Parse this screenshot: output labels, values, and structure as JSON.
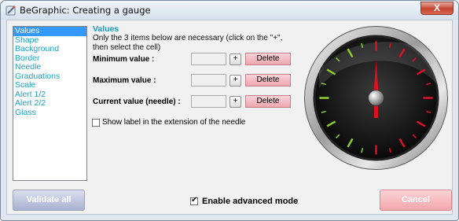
{
  "window": {
    "title": "BeGraphic: Creating a gauge",
    "close_label": "X"
  },
  "sidebar": {
    "items": [
      {
        "label": "Values",
        "selected": true
      },
      {
        "label": "Shape",
        "selected": false
      },
      {
        "label": "Background",
        "selected": false
      },
      {
        "label": "Border",
        "selected": false
      },
      {
        "label": "Needle",
        "selected": false
      },
      {
        "label": "Graduations",
        "selected": false
      },
      {
        "label": "Scale",
        "selected": false
      },
      {
        "label": "Alert 1/2",
        "selected": false
      },
      {
        "label": "Alert 2/2",
        "selected": false
      },
      {
        "label": "Glass",
        "selected": false
      }
    ]
  },
  "values_panel": {
    "title": "Values",
    "info": "Only the 3 items below are necessary (click on the \"+\", then select the cell)",
    "fields": [
      {
        "label": "Minimum value :",
        "value": "",
        "plus": "+",
        "delete": "Delete"
      },
      {
        "label": "Maximum value :",
        "value": "",
        "plus": "+",
        "delete": "Delete"
      },
      {
        "label": "Current value (needle) :",
        "value": "",
        "plus": "+",
        "delete": "Delete"
      }
    ],
    "show_label": {
      "text": "Show label in the extension of the needle",
      "checked": false
    }
  },
  "gauge_preview": {
    "tick_color_green": "#8fd12c",
    "tick_color_red": "#e0102a",
    "needle_color": "#e01020"
  },
  "footer": {
    "validate_label": "Validate all",
    "advanced_mode": {
      "text": "Enable advanced mode",
      "checked": true
    },
    "cancel_label": "Cancel"
  },
  "colors": {
    "accent": "#1aa2c6",
    "selection": "#3399ff",
    "delete": "#eea6af"
  }
}
